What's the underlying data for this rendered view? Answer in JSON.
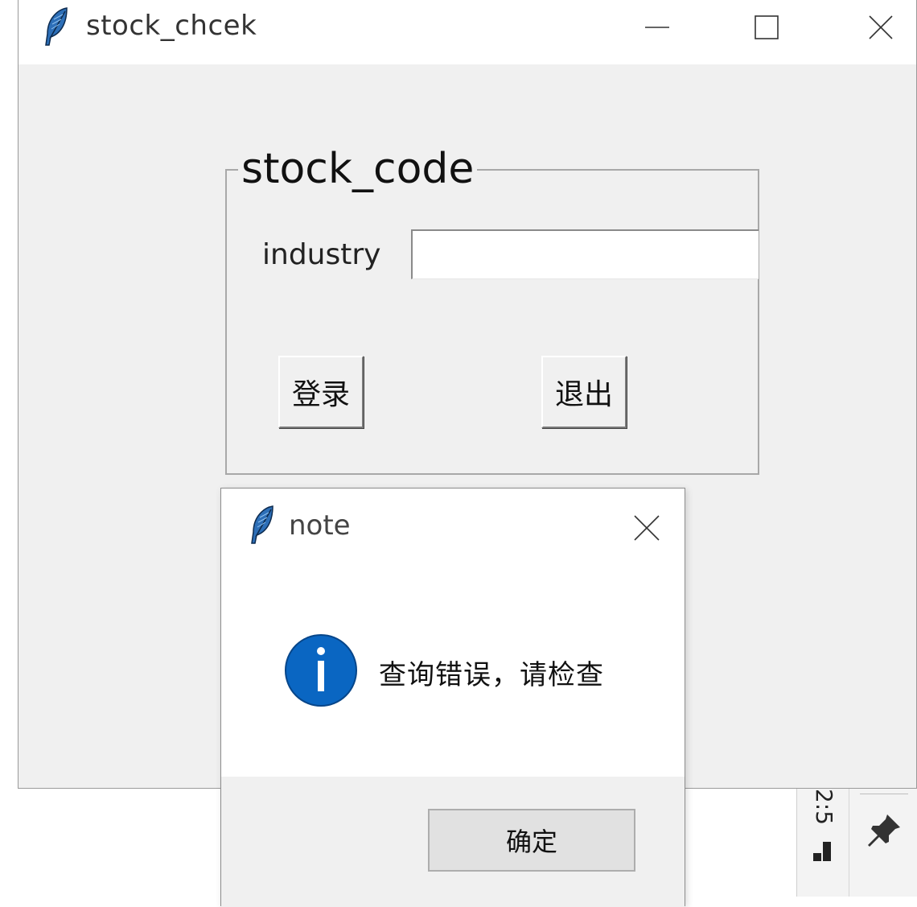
{
  "main_window": {
    "title": "stock_chcek",
    "icon": "feather-icon",
    "controls": {
      "minimize": "minimize-icon",
      "maximize": "maximize-icon",
      "close": "close-icon"
    }
  },
  "labelframe": {
    "title": "stock_code",
    "field_label": "industry",
    "entry_value": "",
    "login_label": "登录",
    "exit_label": "退出"
  },
  "dialog": {
    "title": "note",
    "icon": "info-icon",
    "message": "查询错误，请检查",
    "ok_label": "确定"
  },
  "background": {
    "taskbar_text": "2:5"
  },
  "colors": {
    "window_bg": "#f0f0f0",
    "titlebar_bg": "#ffffff",
    "info_blue": "#0a66c2",
    "dialog_footer": "#f0f0f0"
  }
}
